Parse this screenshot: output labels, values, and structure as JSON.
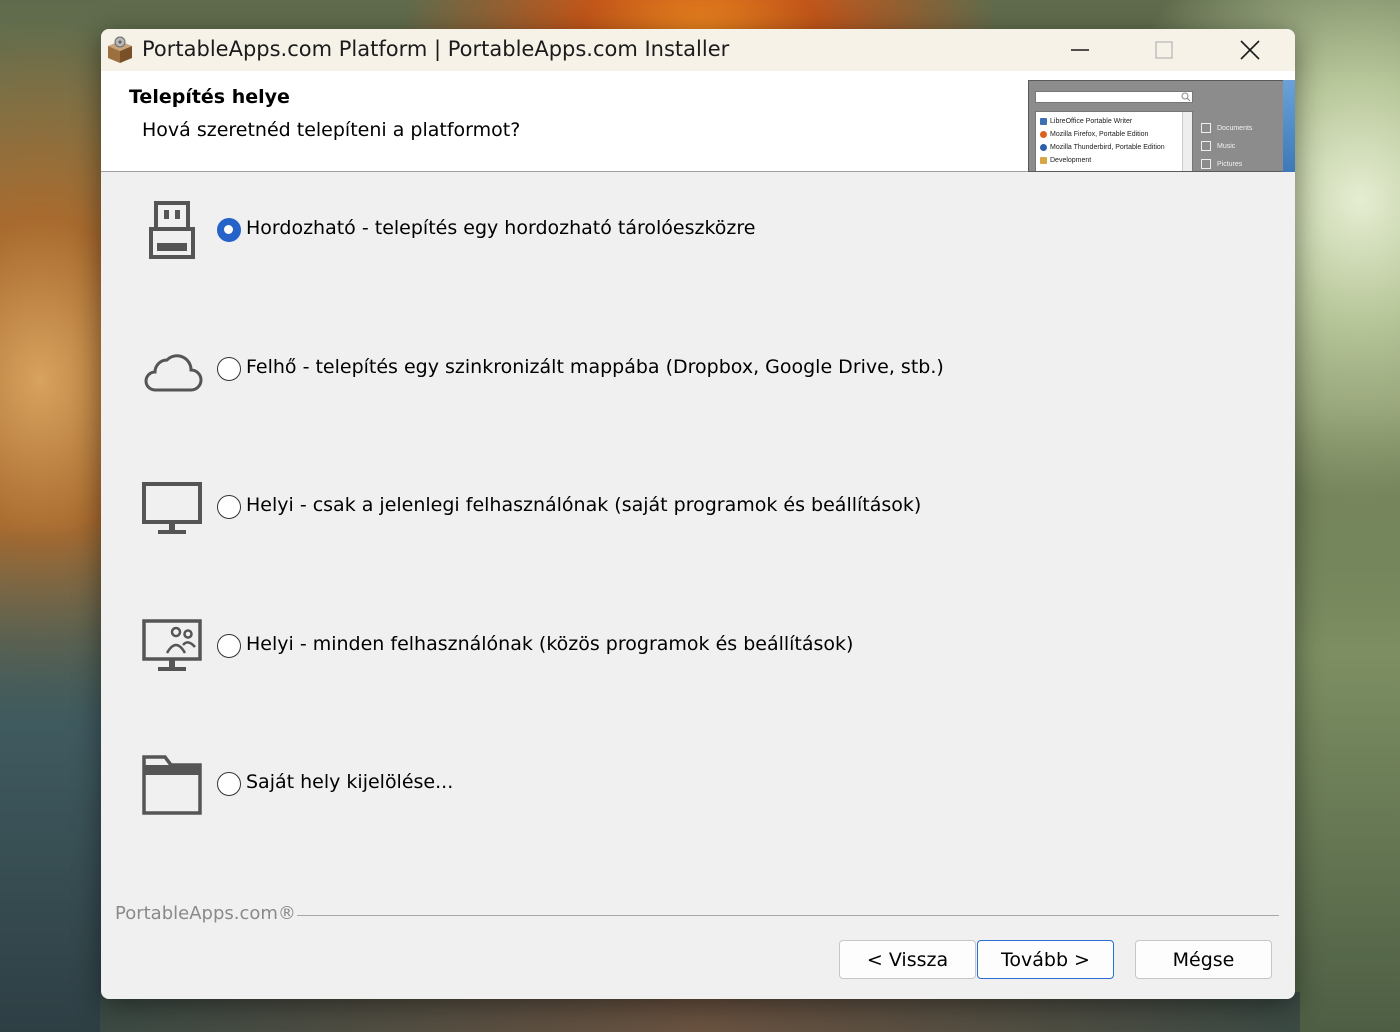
{
  "window": {
    "title": "PortableApps.com Platform | PortableApps.com Installer"
  },
  "header": {
    "title": "Telepítés helye",
    "subtitle": "Hová szeretnéd telepíteni a platformot?"
  },
  "preview": {
    "list_items": [
      "LibreOffice Portable Writer",
      "Mozilla Firefox, Portable Edition",
      "Mozilla Thunderbird, Portable Edition",
      "Development"
    ],
    "side_items": [
      "Documents",
      "Music",
      "Pictures"
    ]
  },
  "options": [
    {
      "label": "Hordozható - telepítés egy hordozható tárolóeszközre",
      "selected": true,
      "icon": "usb-drive-icon"
    },
    {
      "label": "Felhő - telepítés egy szinkronizált mappába (Dropbox, Google Drive, stb.)",
      "selected": false,
      "icon": "cloud-icon"
    },
    {
      "label": "Helyi - csak a jelenlegi felhasználónak (saját programok és beállítások)",
      "selected": false,
      "icon": "monitor-icon"
    },
    {
      "label": "Helyi - minden felhasználónak (közös programok és beállítások)",
      "selected": false,
      "icon": "monitor-users-icon"
    },
    {
      "label": "Saját hely kijelölése...",
      "selected": false,
      "icon": "folder-icon"
    }
  ],
  "footer": {
    "brand": "PortableApps.com®",
    "back_label": "< Vissza",
    "next_label": "Tovább >",
    "cancel_label": "Mégse"
  },
  "colors": {
    "accent": "#2563c9",
    "icon_gray": "#555555"
  }
}
